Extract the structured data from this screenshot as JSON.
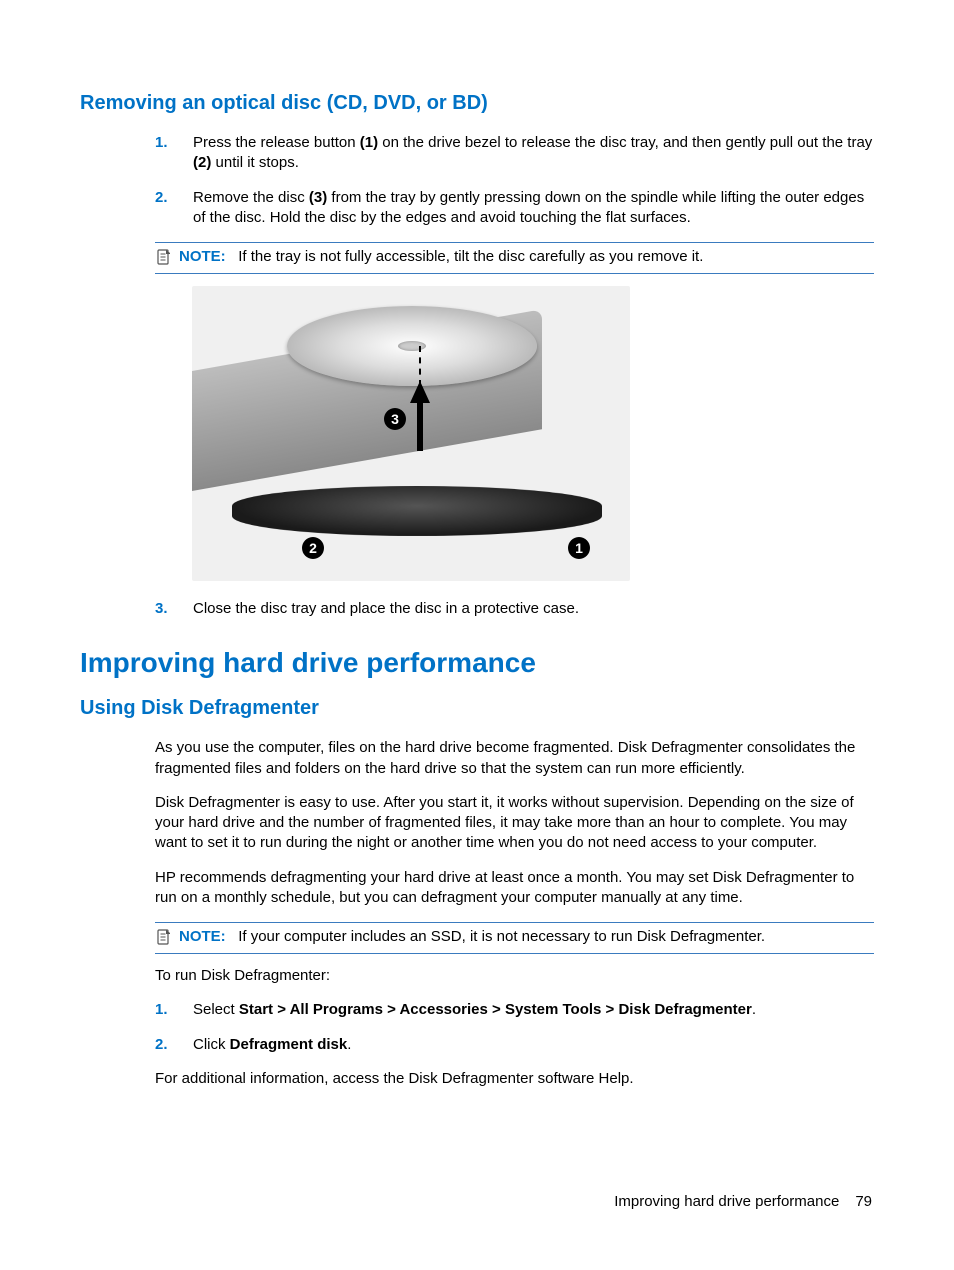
{
  "section1": {
    "heading": "Removing an optical disc (CD, DVD, or BD)",
    "steps": [
      {
        "num": "1.",
        "pre": "Press the release button ",
        "b1": "(1)",
        "mid": " on the drive bezel to release the disc tray, and then gently pull out the tray ",
        "b2": "(2)",
        "post": " until it stops."
      },
      {
        "num": "2.",
        "pre": "Remove the disc ",
        "b1": "(3)",
        "mid": " from the tray by gently pressing down on the spindle while lifting the outer edges of the disc. Hold the disc by the edges and avoid touching the flat surfaces.",
        "b2": "",
        "post": ""
      }
    ],
    "note": {
      "label": "NOTE:",
      "text": "If the tray is not fully accessible, tilt the disc carefully as you remove it."
    },
    "callouts": {
      "c1": "1",
      "c2": "2",
      "c3": "3"
    },
    "step3": {
      "num": "3.",
      "text": "Close the disc tray and place the disc in a protective case."
    }
  },
  "section2": {
    "h1": "Improving hard drive performance",
    "h2": "Using Disk Defragmenter",
    "p1": "As you use the computer, files on the hard drive become fragmented. Disk Defragmenter consolidates the fragmented files and folders on the hard drive so that the system can run more efficiently.",
    "p2": "Disk Defragmenter is easy to use. After you start it, it works without supervision. Depending on the size of your hard drive and the number of fragmented files, it may take more than an hour to complete. You may want to set it to run during the night or another time when you do not need access to your computer.",
    "p3": "HP recommends defragmenting your hard drive at least once a month. You may set Disk Defragmenter to run on a monthly schedule, but you can defragment your computer manually at any time.",
    "note": {
      "label": "NOTE:",
      "text": "If your computer includes an SSD, it is not necessary to run Disk Defragmenter."
    },
    "p4": "To run Disk Defragmenter:",
    "steps": [
      {
        "num": "1.",
        "pre": "Select ",
        "bold": "Start > All Programs > Accessories > System Tools > Disk Defragmenter",
        "post": "."
      },
      {
        "num": "2.",
        "pre": "Click ",
        "bold": "Defragment disk",
        "post": "."
      }
    ],
    "p5": "For additional information, access the Disk Defragmenter software Help."
  },
  "footer": {
    "title": "Improving hard drive performance",
    "page": "79"
  }
}
